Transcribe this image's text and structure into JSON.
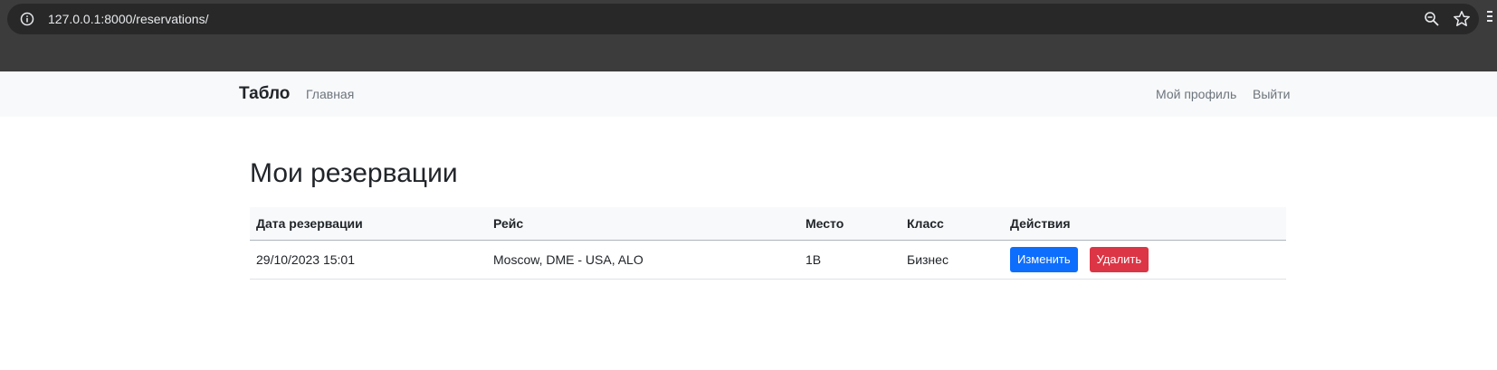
{
  "browser": {
    "url": "127.0.0.1:8000/reservations/"
  },
  "navbar": {
    "brand": "Табло",
    "home": "Главная",
    "profile": "Мой профиль",
    "logout": "Выйти"
  },
  "main": {
    "title": "Мои резервации",
    "table": {
      "headers": [
        "Дата резервации",
        "Рейс",
        "Место",
        "Класс",
        "Действия"
      ],
      "rows": [
        {
          "date": "29/10/2023 15:01",
          "flight": "Moscow, DME - USA, ALO",
          "seat": "1B",
          "class": "Бизнес",
          "edit_label": "Изменить",
          "delete_label": "Удалить"
        }
      ]
    }
  },
  "icons": {
    "info": "info-circle-icon",
    "zoom": "zoom-out-icon",
    "bookmark": "star-icon"
  },
  "colors": {
    "primary": "#0d6efd",
    "danger": "#dc3545",
    "navbar_bg": "#f8f9fa"
  }
}
